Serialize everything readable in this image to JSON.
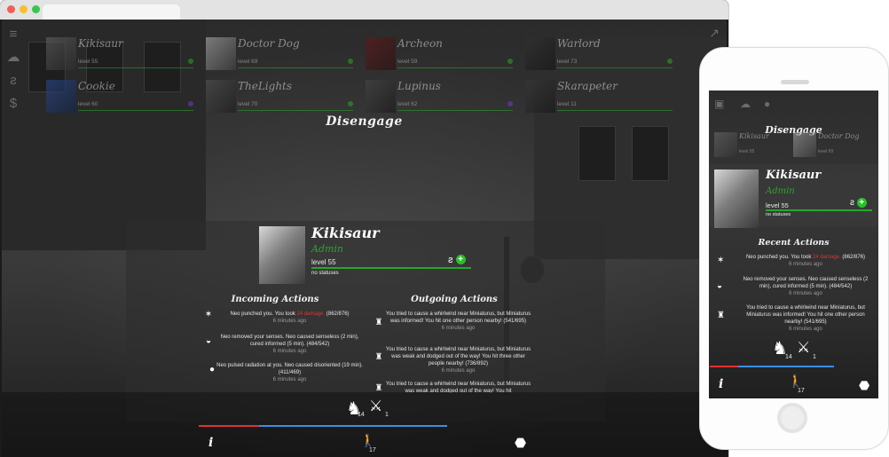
{
  "players": [
    {
      "name": "Kikisaur",
      "level": "level 55"
    },
    {
      "name": "Doctor Dog",
      "level": "level 69"
    },
    {
      "name": "Archeon",
      "level": "level 59"
    },
    {
      "name": "Warlord",
      "level": "level 73"
    },
    {
      "name": "Cookie",
      "level": "level 60"
    },
    {
      "name": "TheLights",
      "level": "level 70"
    },
    {
      "name": "Lupinus",
      "level": "level 62"
    },
    {
      "name": "Skarapeter",
      "level": "level 11"
    }
  ],
  "disengage_label": "Disengage",
  "profile": {
    "name": "Kikisaur",
    "role": "Admin",
    "level": "level 55",
    "status": "no statuses",
    "level_progress": 0.85
  },
  "incoming": {
    "title": "Incoming Actions",
    "items": [
      {
        "pre": "Neo punched you. You took ",
        "damage": "24 damage.",
        "post": " (862/876)",
        "time": "6 minutes ago",
        "icon": "punch-icon"
      },
      {
        "pre": "Neo removed your senses. Neo caused senseless (2 min), cured informed (5 min). (484/542)",
        "time": "6 minutes ago",
        "icon": "eye-icon"
      },
      {
        "pre": "Neo pulsed radiation at you. Neo caused disoriented (19 min). (411/469)",
        "time": "6 minutes ago",
        "icon": "radiation-icon"
      }
    ]
  },
  "outgoing": {
    "title": "Outgoing Actions",
    "items": [
      {
        "text": "You tried to cause a whirlwind near Miniaturus, but Miniaturus was informed! You hit one other person nearby! (541/695)",
        "time": "6 minutes ago",
        "icon": "whirlwind-icon"
      },
      {
        "text": "You tried to cause a whirlwind near Miniaturus, but Miniaturus was weak and dodged out of the way! You hit three other people nearby! (736/892)",
        "time": "6 minutes ago",
        "icon": "whirlwind-icon"
      },
      {
        "text": "You tried to cause a whirlwind near Miniaturus, but Miniaturus was weak and dodged out of the way! You hit",
        "time": "",
        "icon": "whirlwind-icon"
      }
    ]
  },
  "bottom": {
    "pet_count": "14",
    "weapon_count": "1",
    "move_count": "17",
    "info_label": "i",
    "hp_fraction": 0.24,
    "energy_fraction": 1.0
  },
  "mobile": {
    "disengage_label": "Disengage",
    "players": [
      {
        "name": "Kikisaur",
        "level": "level 55"
      },
      {
        "name": "Doctor Dog",
        "level": "level 69"
      }
    ],
    "profile": {
      "name": "Kikisaur",
      "role": "Admin",
      "level": "level 55",
      "status": "no statuses"
    },
    "recent_title": "Recent Actions",
    "actions": [
      {
        "pre": "Neo punched you. You took ",
        "damage": "24 damage.",
        "post": " (862/876)",
        "time": "6 minutes ago"
      },
      {
        "pre": "Neo removed your senses. Neo caused senseless (2 min), cured informed (5 min). (484/542)",
        "time": "6 minutes ago"
      },
      {
        "pre": "You tried to cause a whirlwind near Miniaturus, but Miniaturus was informed! You hit one other person nearby! (541/695)",
        "time": "6 minutes ago"
      }
    ],
    "pet_count": "14",
    "weapon_count": "1",
    "move_count": "17",
    "info_label": "i"
  },
  "colors": {
    "accent_green": "#2aa52a",
    "damage_red": "#e03131",
    "energy_blue": "#3b8ee8"
  }
}
